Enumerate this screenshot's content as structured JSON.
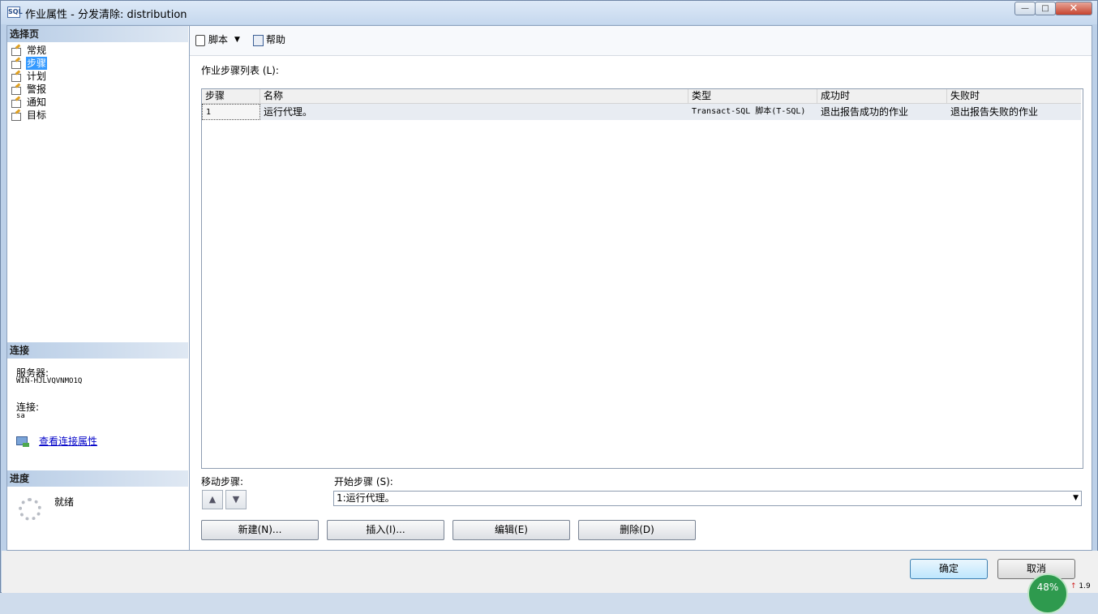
{
  "window": {
    "title": "作业属性 - 分发清除: distribution",
    "icon": "sql-job-icon",
    "buttons": {
      "minimize": "▭",
      "maximize": "□",
      "close": "✕"
    }
  },
  "left": {
    "select_page_header": "选择页",
    "nav": [
      {
        "label": "常规",
        "icon": "page-icon"
      },
      {
        "label": "步骤",
        "icon": "page-icon",
        "selected": true
      },
      {
        "label": "计划",
        "icon": "page-icon"
      },
      {
        "label": "警报",
        "icon": "page-icon"
      },
      {
        "label": "通知",
        "icon": "page-icon"
      },
      {
        "label": "目标",
        "icon": "page-icon"
      }
    ],
    "connection_header": "连接",
    "server_label": "服务器:",
    "server_value": "WIN-HJLVQVNMO1Q",
    "conn_label": "连接:",
    "conn_value": "sa",
    "view_conn_link": "查看连接属性",
    "progress_header": "进度",
    "progress_status": "就绪"
  },
  "toolbar": {
    "script_label": "脚本",
    "help_label": "帮助"
  },
  "steps": {
    "list_label": "作业步骤列表 (L):",
    "columns": [
      "步骤",
      "名称",
      "类型",
      "成功时",
      "失败时"
    ],
    "rows": [
      [
        "1",
        "运行代理。",
        "Transact-SQL 脚本(T-SQL)",
        "退出报告成功的作业",
        "退出报告失败的作业"
      ]
    ],
    "move_label": "移动步骤:",
    "start_label": "开始步骤 (S):",
    "start_value": "1:运行代理。",
    "buttons": {
      "new": "新建(N)...",
      "insert": "插入(I)...",
      "edit": "编辑(E)",
      "delete": "删除(D)"
    }
  },
  "footer": {
    "ok": "确定",
    "cancel": "取消"
  },
  "overlay": {
    "gauge": "48%",
    "net": "1.9"
  }
}
